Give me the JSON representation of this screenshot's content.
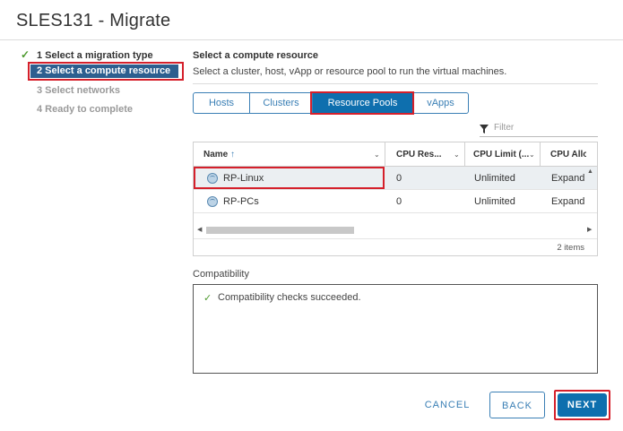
{
  "window": {
    "title": "SLES131 - Migrate"
  },
  "steps": [
    {
      "label": "1 Select a migration type",
      "state": "done"
    },
    {
      "label": "2 Select a compute resource",
      "state": "active"
    },
    {
      "label": "3 Select networks",
      "state": "pending"
    },
    {
      "label": "4 Ready to complete",
      "state": "pending"
    }
  ],
  "section": {
    "title": "Select a compute resource",
    "description": "Select a cluster, host, vApp or resource pool to run the virtual machines."
  },
  "tabs": [
    {
      "label": "Hosts",
      "selected": false
    },
    {
      "label": "Clusters",
      "selected": false
    },
    {
      "label": "Resource Pools",
      "selected": true
    },
    {
      "label": "vApps",
      "selected": false
    }
  ],
  "filter": {
    "placeholder": "Filter"
  },
  "grid": {
    "columns": [
      {
        "label": "Name",
        "sort": "asc"
      },
      {
        "label": "CPU Res..."
      },
      {
        "label": "CPU Limit (..."
      },
      {
        "label": "CPU Allo"
      }
    ],
    "rows": [
      {
        "name": "RP-Linux",
        "cpu_reservation": "0",
        "cpu_limit": "Unlimited",
        "cpu_allocation": "Expand",
        "selected": true
      },
      {
        "name": "RP-PCs",
        "cpu_reservation": "0",
        "cpu_limit": "Unlimited",
        "cpu_allocation": "Expand",
        "selected": false
      }
    ],
    "item_count": "2 items"
  },
  "compatibility": {
    "label": "Compatibility",
    "message": "Compatibility checks succeeded."
  },
  "buttons": {
    "cancel": "CANCEL",
    "back": "BACK",
    "next": "NEXT"
  },
  "colors": {
    "accent": "#0e6fae",
    "link": "#3a7fb5",
    "success": "#4e9a2f",
    "highlight": "#d5202b",
    "active_step": "#2d5f8f"
  },
  "icons": [
    "check-icon",
    "sort-up-icon",
    "chevron-down-icon",
    "filter-icon",
    "resource-pool-icon",
    "scroll-left-icon",
    "scroll-right-icon",
    "scroll-up-icon"
  ]
}
